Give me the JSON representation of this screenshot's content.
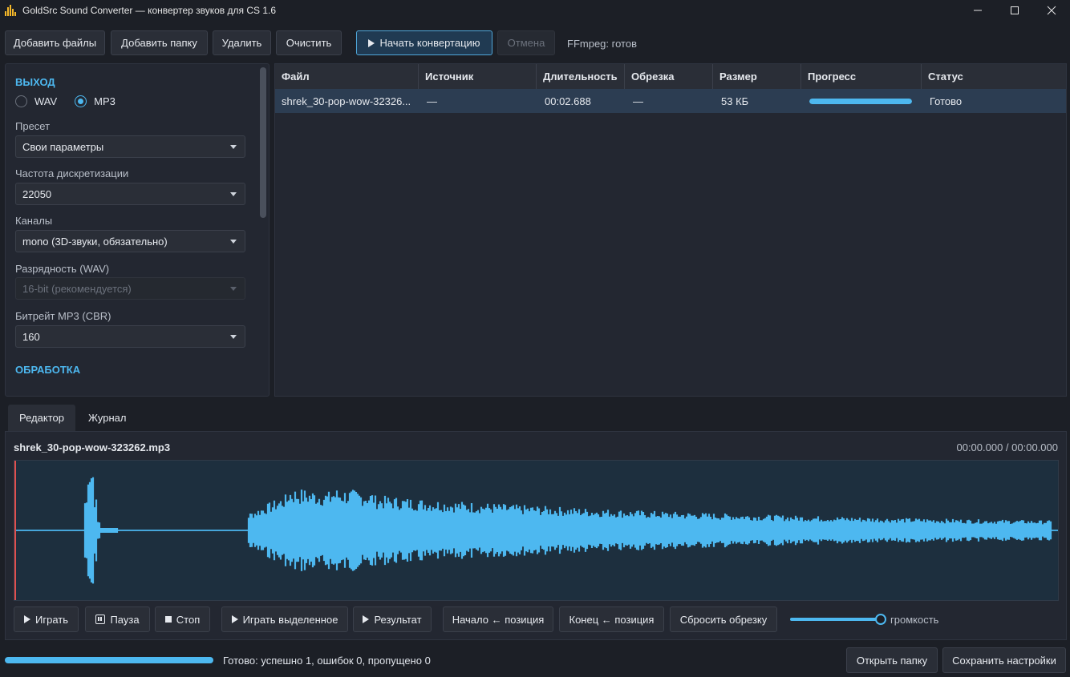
{
  "window": {
    "title": "GoldSrc Sound Converter — конвертер звуков для CS 1.6",
    "minimize_icon": "minimize-icon",
    "maximize_icon": "maximize-icon",
    "close_icon": "close-icon"
  },
  "toolbar": {
    "add_files": "Добавить файлы",
    "add_folder": "Добавить папку",
    "delete": "Удалить",
    "clear": "Очистить",
    "start": "Начать конвертацию",
    "cancel": "Отмена",
    "ffmpeg_status": "FFmpeg: готов"
  },
  "settings": {
    "output_title": "ВЫХОД",
    "format_options": [
      "WAV",
      "MP3"
    ],
    "format_selected": "MP3",
    "preset_label": "Пресет",
    "preset_value": "Свои параметры",
    "sample_rate_label": "Частота дискретизации",
    "sample_rate_value": "22050",
    "channels_label": "Каналы",
    "channels_value": "mono (3D-звуки, обязательно)",
    "bit_depth_label": "Разрядность (WAV)",
    "bit_depth_value": "16-bit (рекомендуется)",
    "bitrate_label": "Битрейт MP3 (CBR)",
    "bitrate_value": "160",
    "processing_title": "ОБРАБОТКА"
  },
  "table": {
    "columns": [
      "Файл",
      "Источник",
      "Длительность",
      "Обрезка",
      "Размер",
      "Прогресс",
      "Статус"
    ],
    "rows": [
      {
        "file": "shrek_30-pop-wow-32326...",
        "source": "—",
        "duration": "00:02.688",
        "trim": "—",
        "size": "53 КБ",
        "progress": 1.0,
        "status": "Готово"
      }
    ]
  },
  "tabs": [
    "Редактор",
    "Журнал"
  ],
  "active_tab": "Редактор",
  "editor": {
    "file_name": "shrek_30-pop-wow-323262.mp3",
    "time": "00:00.000 / 00:00.000",
    "waveform_color": "#4db8f0",
    "playhead_color": "#e0504f",
    "buttons": {
      "play": "Играть",
      "pause": "Пауза",
      "stop": "Стоп",
      "play_selection": "Играть выделенное",
      "result": "Результат",
      "start_pos": "Начало ← позиция",
      "end_pos": "Конец ← позиция",
      "reset_trim": "Сбросить обрезку"
    },
    "volume_label": "громкость",
    "volume_level": 1.0
  },
  "statusbar": {
    "progress": 1.0,
    "text": "Готово: успешно 1, ошибок 0, пропущено 0",
    "open_folder": "Открыть папку",
    "save_settings": "Сохранить настройки"
  },
  "colors": {
    "accent": "#4db8f0",
    "background": "#1c1f26",
    "panel": "#232731",
    "selected_row": "#2c3d52"
  }
}
